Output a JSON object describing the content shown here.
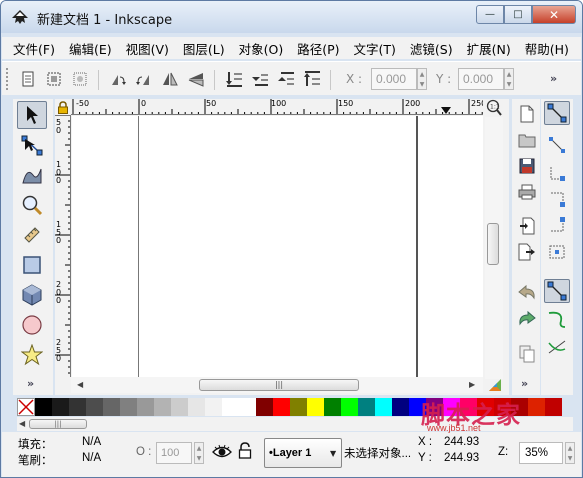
{
  "window": {
    "title": "新建文档 1 - Inkscape",
    "minimize": "—",
    "maximize": "□",
    "close": "✕"
  },
  "menu": [
    "文件(F)",
    "编辑(E)",
    "视图(V)",
    "图层(L)",
    "对象(O)",
    "路径(P)",
    "文字(T)",
    "滤镜(S)",
    "扩展(N)",
    "帮助(H)"
  ],
  "toolbar": {
    "x_label": "X :",
    "x_value": "0.000",
    "y_label": "Y :",
    "y_value": "0.000",
    "more": "»"
  },
  "rulers": {
    "horizontal": [
      "-50",
      "0",
      "50",
      "100",
      "150",
      "200",
      "250"
    ],
    "vertical": [
      "50",
      "100",
      "150",
      "200",
      "250"
    ]
  },
  "toolbox": {
    "tools": [
      "selector-tool",
      "node-tool",
      "tweak-tool",
      "zoom-tool",
      "measure-tool",
      "rectangle-tool",
      "3d-box-tool",
      "ellipse-tool",
      "star-tool"
    ],
    "more": "»"
  },
  "commands_more": "»",
  "palette": [
    "#000000",
    "#1a1a1a",
    "#333333",
    "#4d4d4d",
    "#666666",
    "#808080",
    "#999999",
    "#b3b3b3",
    "#cccccc",
    "#e6e6e6",
    "#f2f2f2",
    "#ffffff",
    "#ffffff",
    "#800000",
    "#ff0000",
    "#808000",
    "#ffff00",
    "#008000",
    "#00ff00",
    "#008080",
    "#00ffff",
    "#000080",
    "#0000ff",
    "#800080",
    "#ff00ff",
    "#ff0066",
    "#e00000",
    "#cc0000",
    "#aa0000",
    "#dd2200",
    "#c00000"
  ],
  "status": {
    "fill_label": "填充：",
    "fill_value": "N/A",
    "stroke_label": "笔刷：",
    "stroke_value": "N/A",
    "opacity_label": "O :",
    "opacity_value": "100",
    "layer": "•Layer 1",
    "message": "未选择对象...",
    "x_label": "X :",
    "x_value": "244.93",
    "y_label": "Y :",
    "y_value": "244.93",
    "zoom_label": "Z:",
    "zoom_value": "35%"
  },
  "watermark": {
    "text": "脚本之家",
    "url": "www.jb51.net"
  }
}
